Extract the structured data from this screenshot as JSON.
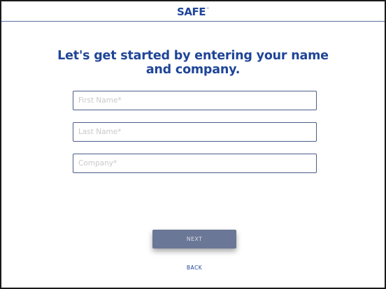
{
  "header": {
    "logo_text": "SAFE",
    "logo_mark": "™"
  },
  "form": {
    "headline": "Let's get started by entering your name and company.",
    "first_name": {
      "value": "",
      "placeholder": "First Name*"
    },
    "last_name": {
      "value": "",
      "placeholder": "Last Name*"
    },
    "company": {
      "value": "",
      "placeholder": "Company*"
    }
  },
  "actions": {
    "next_label": "NEXT",
    "back_label": "BACK"
  },
  "colors": {
    "brand_blue": "#1f4597",
    "button_disabled": "#6b7796",
    "field_border": "#4a5c8a",
    "placeholder": "#c9c9c9"
  }
}
